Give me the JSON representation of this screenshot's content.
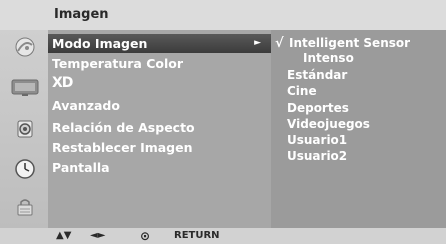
{
  "header": {
    "title": "Imagen"
  },
  "menu": {
    "items": [
      {
        "label": "Modo Imagen",
        "selected": true
      },
      {
        "label": "Temperatura Color"
      },
      {
        "label": "XD"
      },
      {
        "label": "Avanzado"
      },
      {
        "label": "Relación de Aspecto"
      },
      {
        "label": "Restablecer Imagen"
      },
      {
        "label": "Pantalla"
      }
    ],
    "selected_arrow": "►"
  },
  "submenu": {
    "check_mark": "√",
    "options": [
      "Intelligent Sensor",
      "Intenso",
      "Estándar",
      "Cine",
      "Deportes",
      "Videojuegos",
      "Usuario1",
      "Usuario2"
    ],
    "checked_index": 0
  },
  "sidebar_icons": [
    "satellite-dish-icon",
    "tv-screen-icon",
    "speaker-icon",
    "clock-icon",
    "lock-icon"
  ],
  "footer": {
    "nav_up_down": "▲▼",
    "nav_left_right": "◄►",
    "ok_symbol": "⊙",
    "return_label": "RETURN"
  },
  "colors": {
    "background": "#d8d8d8",
    "main_panel": "#a7a7a7",
    "sub_panel": "#9b9b9b",
    "highlight": "#464646",
    "text": "#ffffff"
  }
}
